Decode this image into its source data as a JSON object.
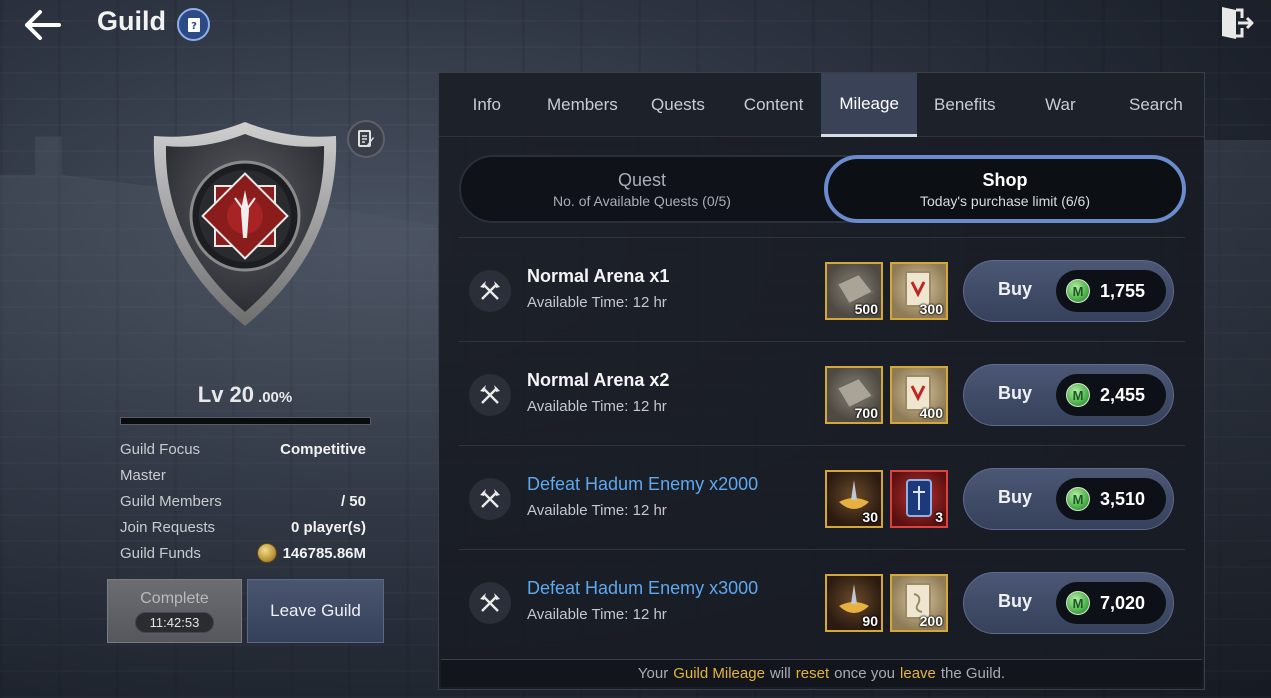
{
  "header": {
    "title": "Guild"
  },
  "guild": {
    "level_label": "Lv 20",
    "level_pct": ".00%",
    "xp_progress": 0.0,
    "info": [
      {
        "label": "Guild Focus",
        "value": "Competitive"
      },
      {
        "label": "Master",
        "value": ""
      },
      {
        "label": "Guild Members",
        "value": "/ 50"
      },
      {
        "label": "Join Requests",
        "value": "0 player(s)"
      },
      {
        "label": "Guild Funds",
        "value": "146785.86M"
      }
    ],
    "complete_label": "Complete",
    "complete_timer": "11:42:53",
    "leave_label": "Leave Guild"
  },
  "tabs": [
    "Info",
    "Members",
    "Quests",
    "Content",
    "Mileage",
    "Benefits",
    "War",
    "Search"
  ],
  "active_tab": "Mileage",
  "toggle": {
    "quest_title": "Quest",
    "quest_sub": "No. of Available Quests (0/5)",
    "shop_title": "Shop",
    "shop_sub": "Today's purchase limit (6/6)"
  },
  "items": [
    {
      "name": "Normal Arena x1",
      "time": "Available Time: 12 hr",
      "rewards": [
        "500",
        "300"
      ],
      "buy": "Buy",
      "price": "1,755"
    },
    {
      "name": "Normal Arena x2",
      "time": "Available Time: 12 hr",
      "rewards": [
        "700",
        "400"
      ],
      "buy": "Buy",
      "price": "2,455"
    },
    {
      "name": "Defeat Hadum Enemy x2000",
      "time": "Available Time: 12 hr",
      "rewards": [
        "30",
        "3"
      ],
      "buy": "Buy",
      "price": "3,510"
    },
    {
      "name": "Defeat Hadum Enemy x3000",
      "time": "Available Time: 12 hr",
      "rewards": [
        "90",
        "200"
      ],
      "buy": "Buy",
      "price": "7,020"
    }
  ],
  "currency_symbol": "M",
  "footer": {
    "p1": "Your",
    "p2": "Guild Mileage",
    "p3": "will",
    "p4": "reset",
    "p5": "once you",
    "p6": "leave",
    "p7": "the Guild."
  },
  "colors": {
    "accent_gold": "#e2b43a",
    "link_blue": "#5ea8f0",
    "active_tab": "#3a4258",
    "shop_border": "#6a8ccc"
  }
}
